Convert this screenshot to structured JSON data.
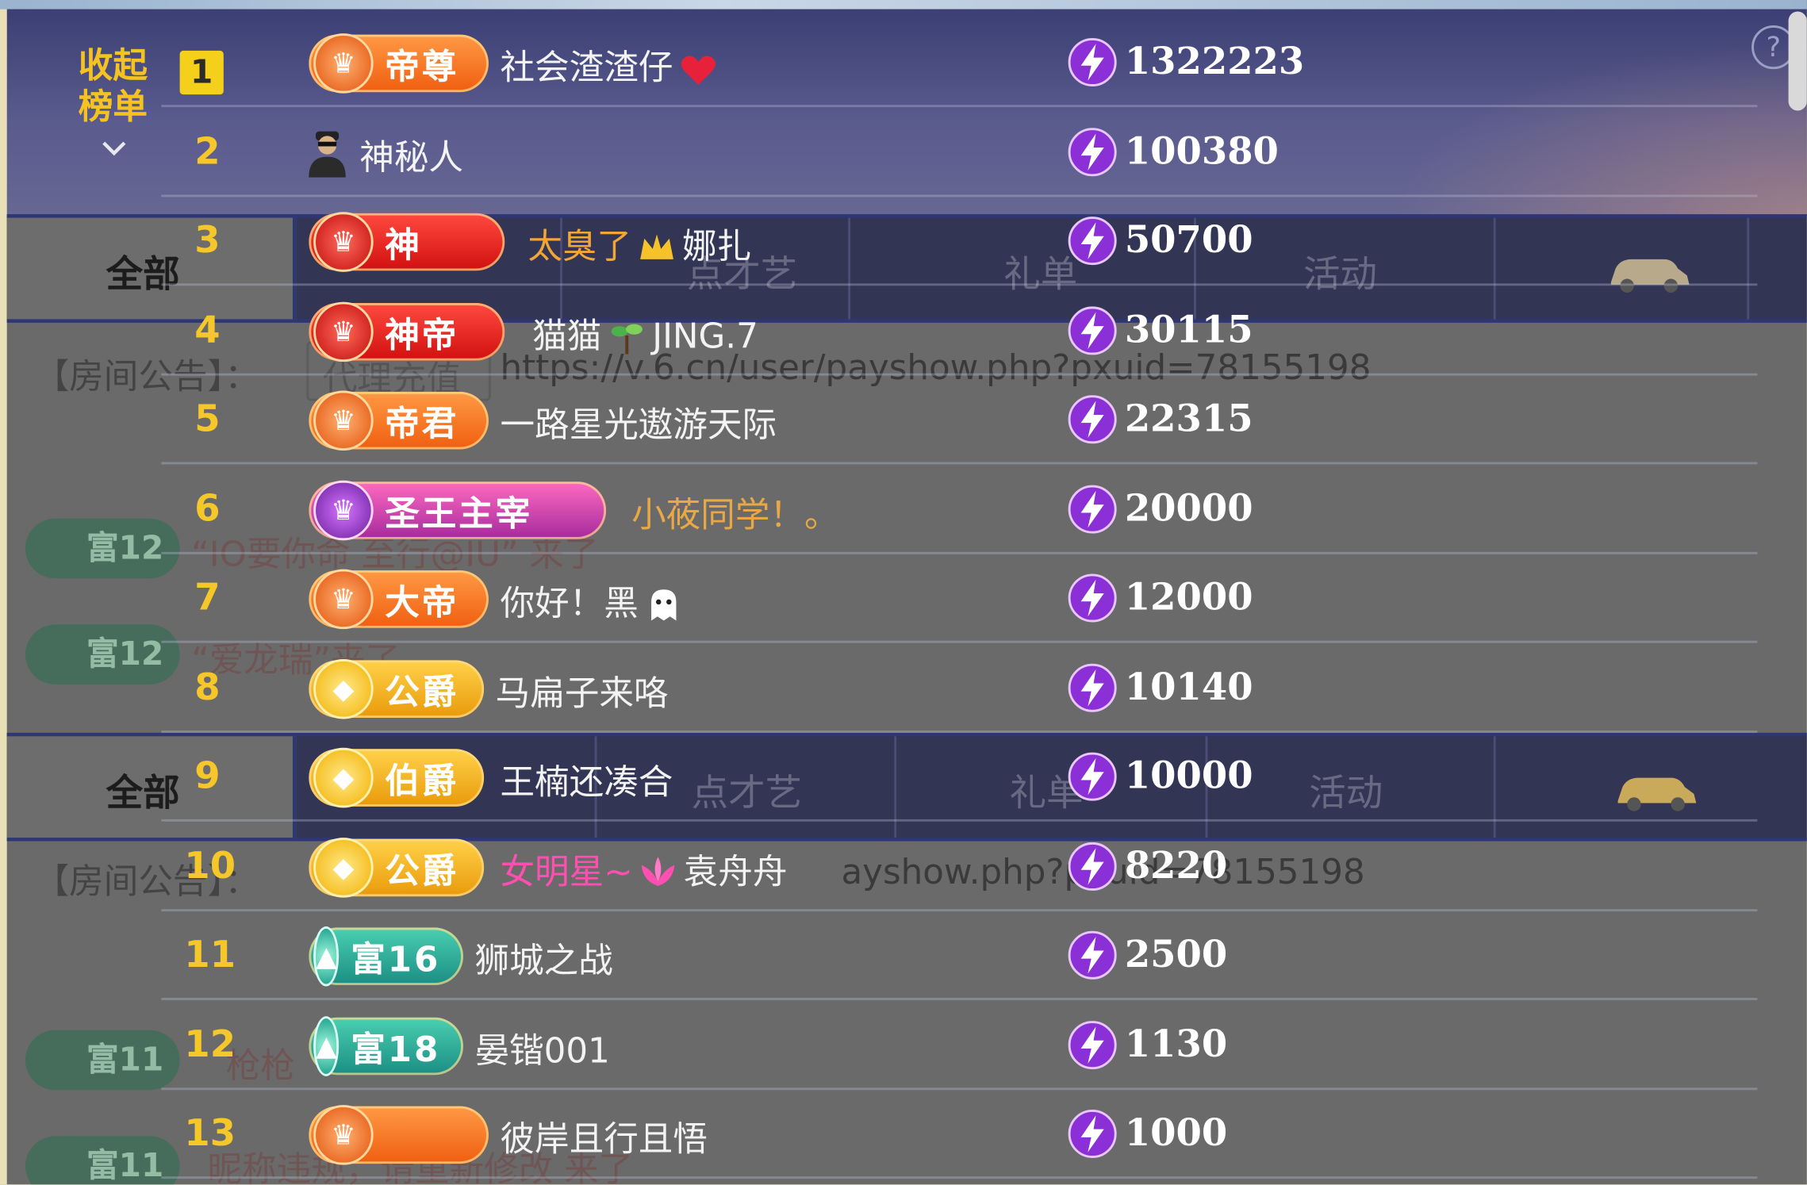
{
  "panel": {
    "collapse_label": "收起榜单",
    "help_glyph": "?"
  },
  "tabs": {
    "all": "全部",
    "ghost_items": [
      "点才艺",
      "礼单",
      "活动"
    ]
  },
  "notice": {
    "label": "【房间公告】：",
    "url": "https://v.6.cn/user/payshow.php?pxuid=78155198",
    "url_tail": "ayshow.php?pxuid=78155198",
    "ghost_recharge": "代理充值"
  },
  "chat_ghosts": [
    {
      "badge": "富12",
      "text": "“IO要你命 至行@IU” 来了"
    },
    {
      "badge": "富12",
      "text": "“爱龙瑞”来了"
    },
    {
      "badge": "富11",
      "text": "枪枪"
    },
    {
      "badge": "富11",
      "text": "昵称违规，请重新修改 来了"
    }
  ],
  "ranking": [
    {
      "rank": "1",
      "badge": "帝尊",
      "badge_style": "orange",
      "name": "社会渣渣仔",
      "name_icon": "heart-icon",
      "name_color": "#f3f3f3",
      "score": "1322223"
    },
    {
      "rank": "2",
      "badge": "",
      "badge_style": "avatar",
      "name": "神秘人",
      "name_icon": "",
      "name_color": "#f3f3f3",
      "score": "100380"
    },
    {
      "rank": "3",
      "badge": "神",
      "badge_style": "red",
      "name": "太臭了",
      "name_suffix": "娜扎",
      "name_icon": "crown-icon",
      "name_color": "#f1a637",
      "score": "50700"
    },
    {
      "rank": "4",
      "badge": "神帝",
      "badge_style": "red",
      "name": "猫猫",
      "name_suffix": "JING.7",
      "name_icon": "sprout-icon",
      "name_color": "#f3f3f3",
      "score": "30115"
    },
    {
      "rank": "5",
      "badge": "帝君",
      "badge_style": "orange",
      "name": "一路星光遨游天际",
      "name_icon": "",
      "name_color": "#f3f3f3",
      "score": "22315"
    },
    {
      "rank": "6",
      "badge": "圣王主宰",
      "badge_style": "purple",
      "name": "小莜同学！。",
      "name_icon": "",
      "name_color": "#e8a846",
      "score": "20000"
    },
    {
      "rank": "7",
      "badge": "大帝",
      "badge_style": "orange",
      "name": "你好！黑",
      "name_icon": "ghost-icon",
      "name_color": "#f3f3f3",
      "score": "12000"
    },
    {
      "rank": "8",
      "badge": "公爵",
      "badge_style": "gold",
      "name": "马扁子来咯",
      "name_icon": "",
      "name_color": "#f3f3f3",
      "score": "10140"
    },
    {
      "rank": "9",
      "badge": "伯爵",
      "badge_style": "gold",
      "name": "王楠还凑合",
      "name_icon": "",
      "name_color": "#f3f3f3",
      "score": "10000"
    },
    {
      "rank": "10",
      "badge": "公爵",
      "badge_style": "gold",
      "name": "女明星~",
      "name_suffix": "袁舟舟",
      "name_icon": "lotus-icon",
      "name_color": "#ff4fb0",
      "score": "8220"
    },
    {
      "rank": "11",
      "badge": "富16",
      "badge_style": "teal",
      "name": "狮城之战",
      "name_icon": "",
      "name_color": "#f3f3f3",
      "score": "2500"
    },
    {
      "rank": "12",
      "badge": "富18",
      "badge_style": "teal",
      "name": "晏锴001",
      "name_icon": "",
      "name_color": "#f3f3f3",
      "score": "1130"
    },
    {
      "rank": "13",
      "badge": "",
      "badge_style": "orange",
      "name": "彼岸且行且悟",
      "name_icon": "",
      "name_color": "#f3f3f3",
      "score": "1000"
    }
  ]
}
